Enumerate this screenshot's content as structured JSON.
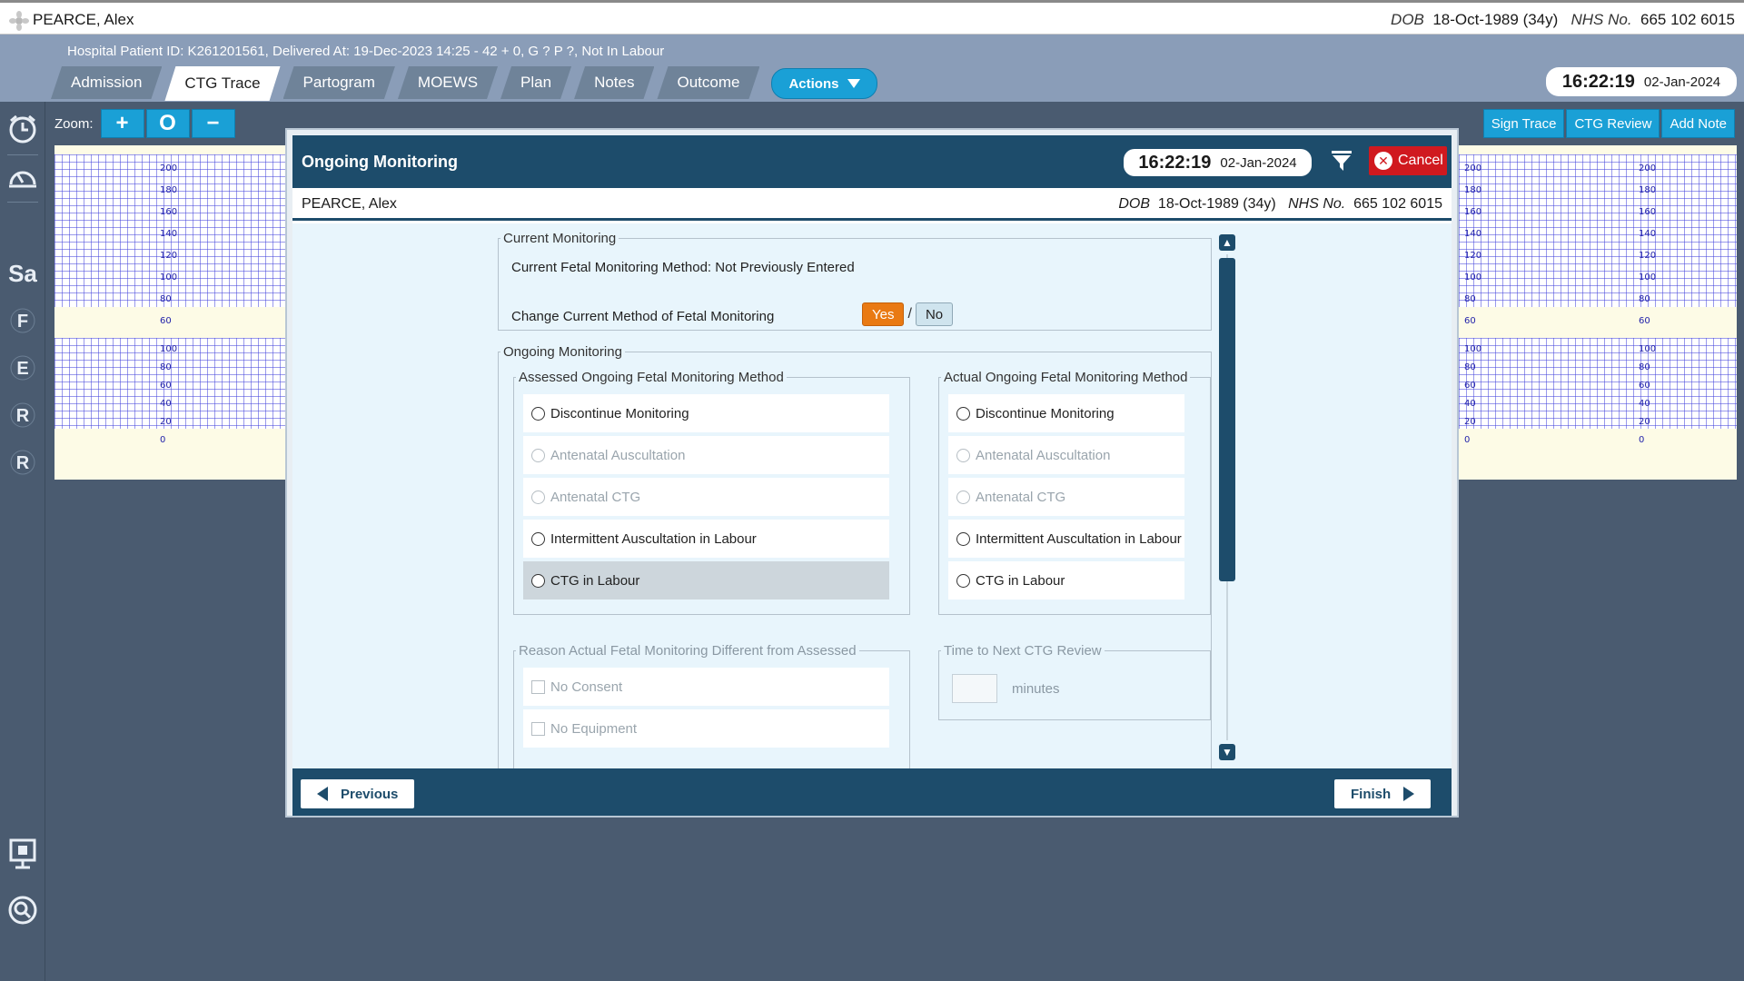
{
  "patient": {
    "name": "PEARCE, Alex",
    "dob_label": "DOB",
    "dob": "18-Oct-1989 (34y)",
    "nhs_label": "NHS No.",
    "nhs": "665 102 6015"
  },
  "header": {
    "hospital_line": "Hospital Patient ID: K261201561, Delivered At: 19-Dec-2023 14:25 - 42 + 0, G ? P ?,   Not In Labour",
    "tabs": [
      {
        "label": "Admission"
      },
      {
        "label": "CTG Trace"
      },
      {
        "label": "Partogram"
      },
      {
        "label": "MOEWS"
      },
      {
        "label": "Plan"
      },
      {
        "label": "Notes"
      },
      {
        "label": "Outcome"
      }
    ],
    "active_tab": "CTG Trace",
    "actions_label": "Actions",
    "time": "16:22:19",
    "date": "02-Jan-2024"
  },
  "sidebar": {
    "items": [
      {
        "icon": "alarm-clock-icon",
        "glyph": ""
      },
      {
        "icon": "gauge-icon",
        "glyph": ""
      },
      {
        "icon": "sa-letter-icon",
        "glyph": "Sa"
      },
      {
        "icon": "f-letter-icon",
        "glyph": "F"
      },
      {
        "icon": "e-letter-icon",
        "glyph": "E"
      },
      {
        "icon": "r-letter-icon",
        "glyph": "R"
      },
      {
        "icon": "r-letter-icon-2",
        "glyph": "R"
      }
    ],
    "bottom": [
      {
        "icon": "presentation-icon"
      },
      {
        "icon": "search-icon"
      }
    ]
  },
  "toolbar": {
    "zoom_label": "Zoom:",
    "zoom_in": "+",
    "zoom_reset": "O",
    "zoom_out": "−",
    "sign_trace": "Sign Trace",
    "ctg_review": "CTG Review",
    "add_note": "Add Note"
  },
  "ctg_scale": {
    "fhr_ticks": [
      "200",
      "180",
      "160",
      "140",
      "120",
      "100",
      "80",
      "60"
    ],
    "toco_ticks": [
      "100",
      "80",
      "60",
      "40",
      "20",
      "0"
    ]
  },
  "modal": {
    "title": "Ongoing Monitoring",
    "time": "16:22:19",
    "date": "02-Jan-2024",
    "cancel_label": "Cancel",
    "current": {
      "legend": "Current Monitoring",
      "method_text": "Current Fetal Monitoring Method: Not Previously Entered",
      "change_label": "Change Current Method of Fetal Monitoring",
      "yes": "Yes",
      "slash": "/",
      "no": "No",
      "selected": "Yes"
    },
    "ongoing": {
      "legend": "Ongoing Monitoring",
      "assessed": {
        "legend": "Assessed Ongoing Fetal Monitoring Method",
        "options": [
          {
            "label": "Discontinue Monitoring",
            "enabled": true
          },
          {
            "label": "Antenatal Auscultation",
            "enabled": false
          },
          {
            "label": "Antenatal CTG",
            "enabled": false
          },
          {
            "label": "Intermittent Auscultation in Labour",
            "enabled": true
          },
          {
            "label": "CTG in Labour",
            "enabled": true,
            "highlighted": true
          }
        ]
      },
      "actual": {
        "legend": "Actual Ongoing Fetal Monitoring Method",
        "options": [
          {
            "label": "Discontinue Monitoring",
            "enabled": true
          },
          {
            "label": "Antenatal Auscultation",
            "enabled": false
          },
          {
            "label": "Antenatal CTG",
            "enabled": false
          },
          {
            "label": "Intermittent Auscultation in Labour",
            "enabled": true
          },
          {
            "label": "CTG in Labour",
            "enabled": true
          }
        ]
      },
      "reason": {
        "legend": "Reason Actual Fetal Monitoring Different from Assessed",
        "options": [
          {
            "label": "No Consent"
          },
          {
            "label": "No Equipment"
          }
        ]
      },
      "next_review": {
        "legend": "Time to Next CTG Review",
        "value": "",
        "unit": "minutes"
      }
    },
    "previous_label": "Previous",
    "finish_label": "Finish"
  },
  "colors": {
    "header_bg": "#8a9db8",
    "modal_navy": "#1d4c6b",
    "accent_blue": "#1aa0d6",
    "yes_orange": "#e97a13",
    "cancel_red": "#d0191f"
  }
}
